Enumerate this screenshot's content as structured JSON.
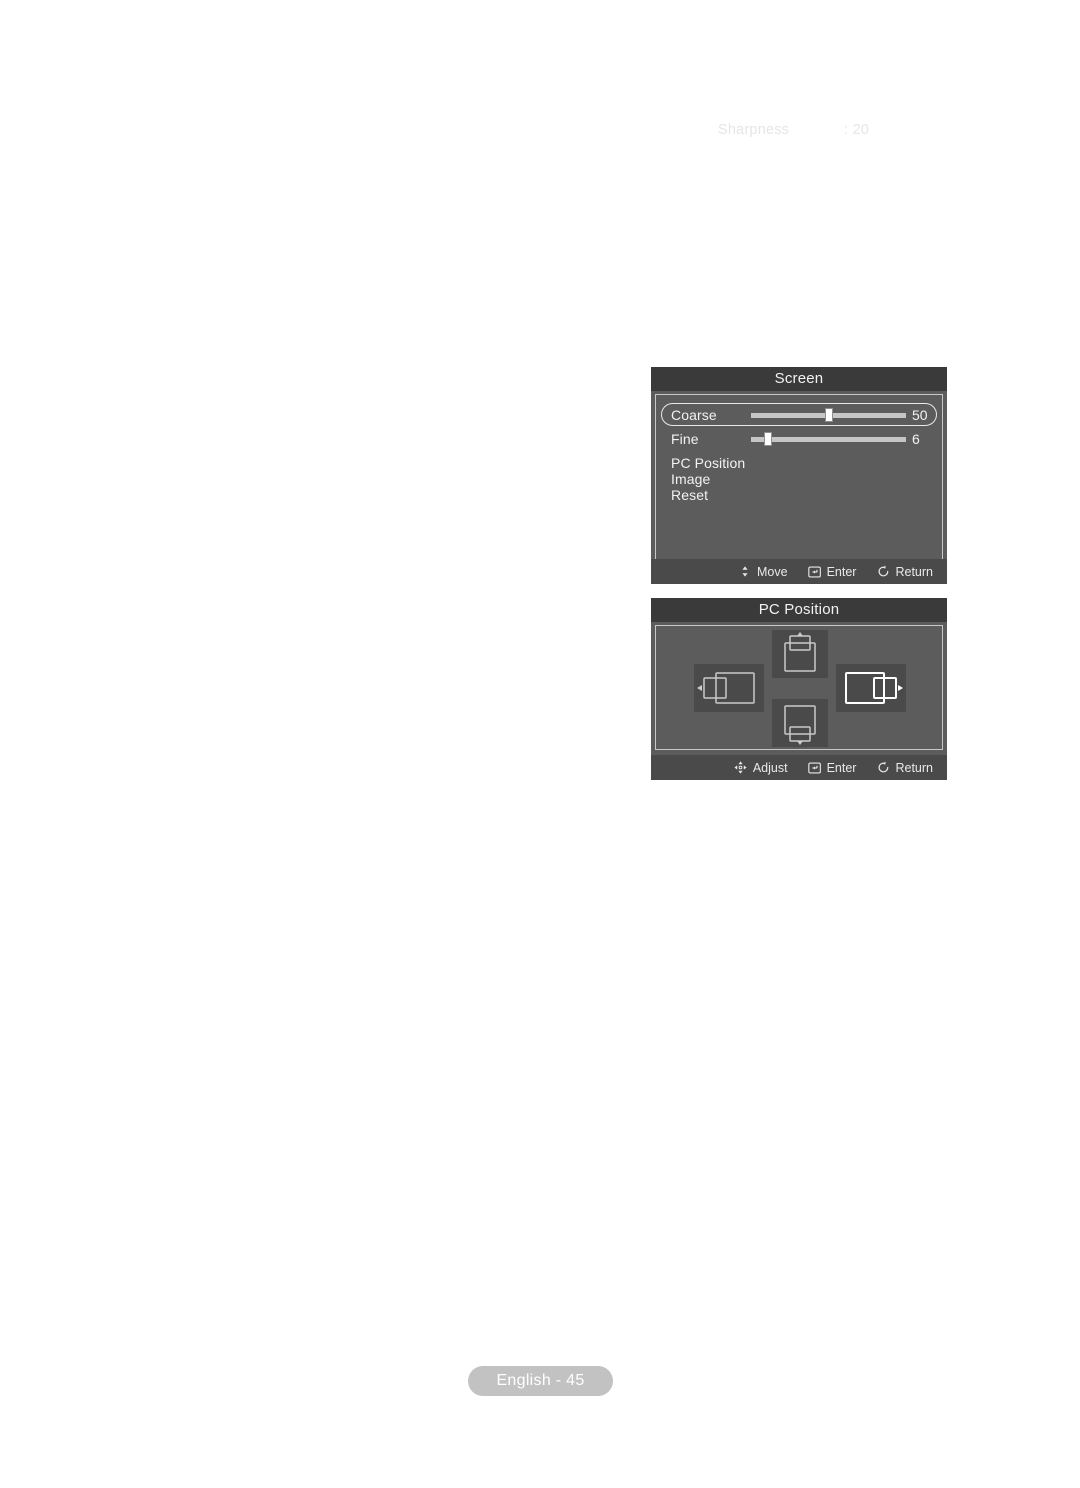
{
  "ghost_text": {
    "label": "Sharpness",
    "value": ": 20"
  },
  "screen_dialog": {
    "title": "Screen",
    "items": [
      {
        "label": "Coarse",
        "value": "50",
        "slider": true,
        "percent": 50,
        "selected": true
      },
      {
        "label": "Fine",
        "value": "6",
        "slider": true,
        "percent": 11,
        "selected": false
      },
      {
        "label": "PC Position",
        "value": "",
        "slider": false,
        "percent": 0,
        "selected": false
      },
      {
        "label": "Image Reset",
        "value": "",
        "slider": false,
        "percent": 0,
        "selected": false
      }
    ],
    "hints": [
      {
        "icon": "up-down-arrow-icon",
        "label": "Move"
      },
      {
        "icon": "enter-key-icon",
        "label": "Enter"
      },
      {
        "icon": "return-arrow-icon",
        "label": "Return"
      }
    ]
  },
  "pc_position_dialog": {
    "title": "PC Position",
    "directions": [
      {
        "name": "up",
        "icon": "move-up-icon",
        "selected": false
      },
      {
        "name": "down",
        "icon": "move-down-icon",
        "selected": false
      },
      {
        "name": "left",
        "icon": "move-left-icon",
        "selected": false
      },
      {
        "name": "right",
        "icon": "move-right-icon",
        "selected": true
      }
    ],
    "hints": [
      {
        "icon": "four-way-arrow-icon",
        "label": "Adjust"
      },
      {
        "icon": "enter-key-icon",
        "label": "Enter"
      },
      {
        "icon": "return-arrow-icon",
        "label": "Return"
      }
    ]
  },
  "page_footer": {
    "label": "English - 45"
  },
  "colors": {
    "dialog_title_bg": "#3a3a3a",
    "dialog_body_bg": "#5c5c5c",
    "dialog_footer_bg": "#4a4a4a",
    "tile_bg": "#4a4a4a",
    "text": "#f2f2f2",
    "highlight": "#ffffff",
    "footer_pill_bg": "#c2c2c2"
  }
}
